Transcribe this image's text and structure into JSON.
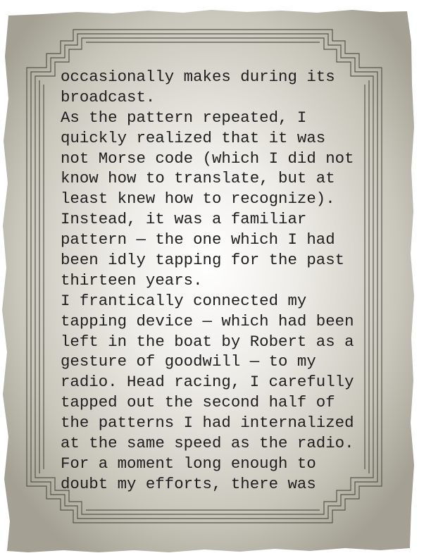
{
  "colors": {
    "paper_center": "#ffffff",
    "paper_mid": "#e7e5df",
    "paper_edge": "#a4a194",
    "frame_line": "#55564c",
    "text": "#1e1e1e"
  },
  "passage": {
    "lines": [
      "occasionally makes during its",
      "broadcast.",
      "As the pattern repeated, I",
      "quickly realized that it was",
      "not Morse code (which I did not",
      "know how to translate, but at",
      "least knew how to recognize).",
      "Instead, it was a familiar",
      "pattern — the one which I had",
      "been idly tapping for the past",
      "thirteen years.",
      "I frantically connected my",
      "tapping device — which had been",
      "left in the boat by Robert as a",
      "gesture of goodwill — to my",
      "radio. Head racing, I carefully",
      "tapped out the second half of",
      "the patterns I had internalized",
      "at the same speed as the radio.",
      "For a moment long enough to",
      "doubt my efforts, there was"
    ]
  }
}
